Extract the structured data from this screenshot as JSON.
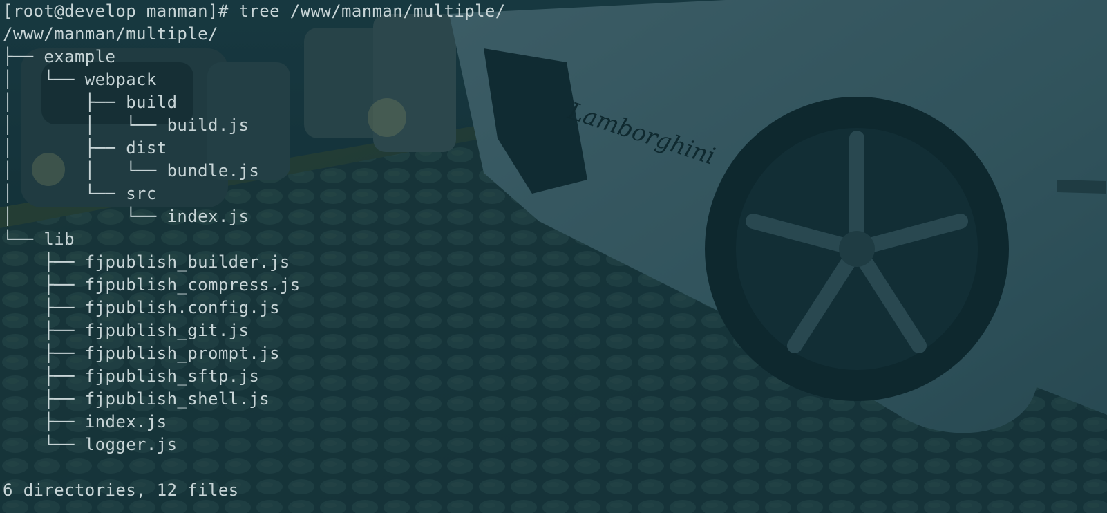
{
  "terminal": {
    "background_color": "#0f2a30",
    "text_color": "#c7d4d6",
    "background_image": "lamborghini-car-on-cobblestone-street",
    "prompt_line": "[root@develop manman]# tree /www/manman/multiple/",
    "tree_root": "/www/manman/multiple/",
    "tree_lines": [
      "├── example",
      "│   └── webpack",
      "│       ├── build",
      "│       │   └── build.js",
      "│       ├── dist",
      "│       │   └── bundle.js",
      "│       └── src",
      "│           └── index.js",
      "└── lib",
      "    ├── fjpublish_builder.js",
      "    ├── fjpublish_compress.js",
      "    ├── fjpublish.config.js",
      "    ├── fjpublish_git.js",
      "    ├── fjpublish_prompt.js",
      "    ├── fjpublish_sftp.js",
      "    ├── fjpublish_shell.js",
      "    ├── index.js",
      "    └── logger.js"
    ],
    "blank_line": "",
    "summary": "6 directories, 12 files",
    "car_badge_text": "Lamborghini"
  }
}
